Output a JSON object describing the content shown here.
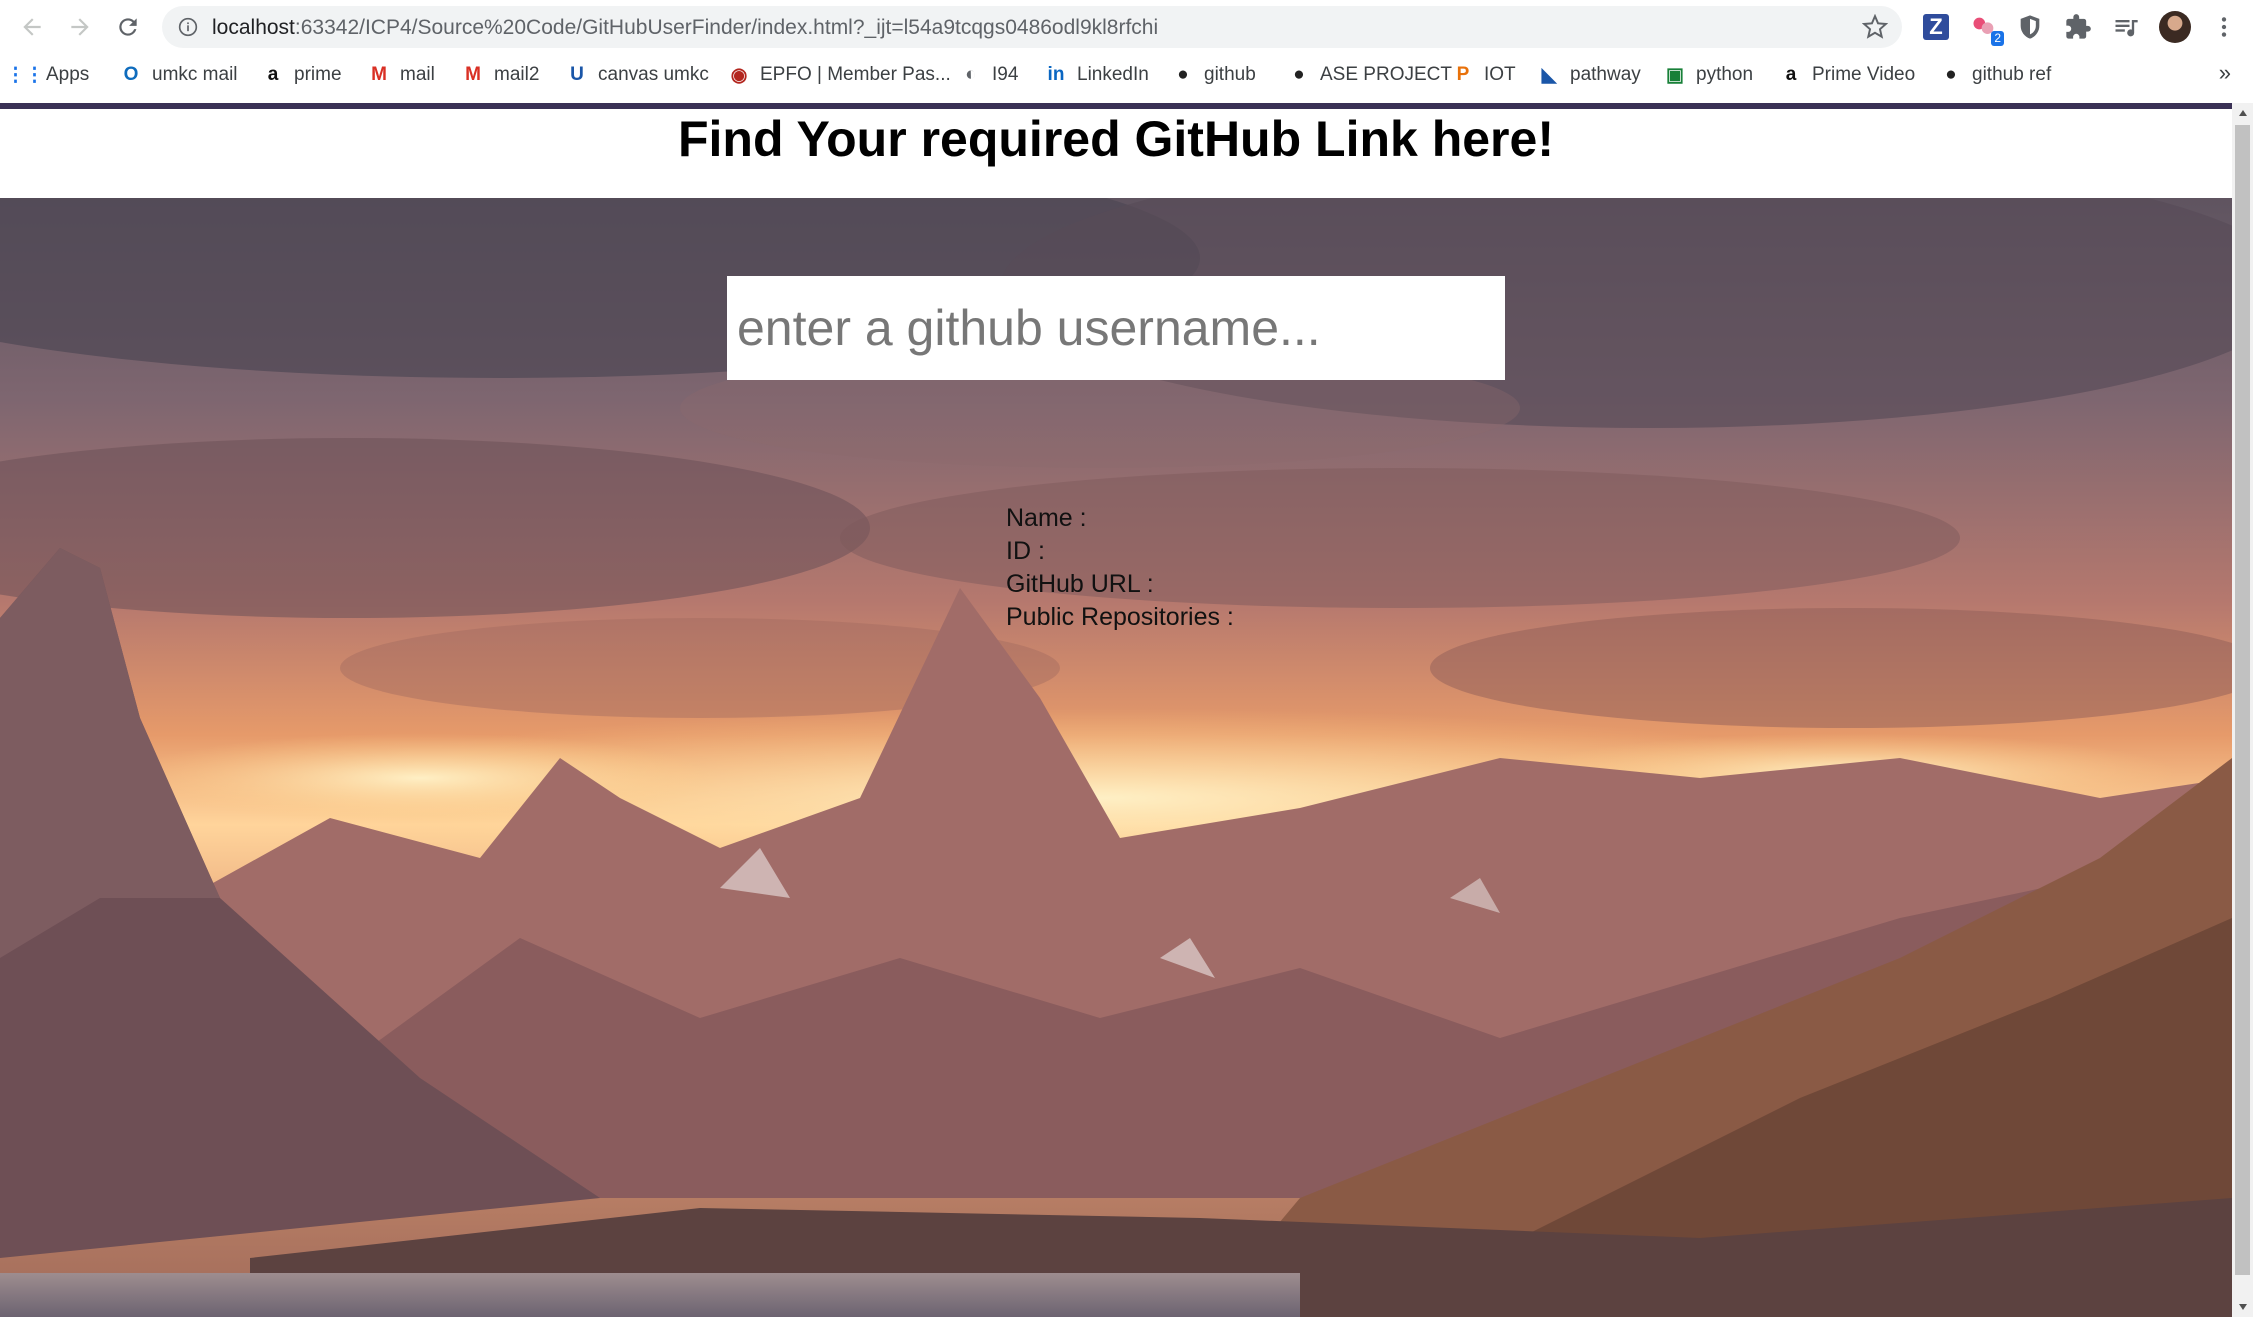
{
  "browser": {
    "url_host": "localhost",
    "url_path": ":63342/ICP4/Source%20Code/GitHubUserFinder/index.html?_ijt=l54a9tcqgs0486odl9kl8rfchi",
    "extension_badge": "2",
    "z_extension_label": "Z",
    "bookmarks": [
      {
        "label": "Apps",
        "icon": "apps-grid-icon"
      },
      {
        "label": "umkc mail",
        "icon": "outlook-icon"
      },
      {
        "label": "prime",
        "icon": "amazon-icon"
      },
      {
        "label": "mail",
        "icon": "gmail-icon"
      },
      {
        "label": "mail2",
        "icon": "gmail-icon"
      },
      {
        "label": "canvas umkc",
        "icon": "umkc-icon"
      },
      {
        "label": "EPFO | Member Pas...",
        "icon": "epfo-icon"
      },
      {
        "label": "I94",
        "icon": "globe-icon"
      },
      {
        "label": "LinkedIn",
        "icon": "linkedin-icon"
      },
      {
        "label": "github",
        "icon": "github-icon"
      },
      {
        "label": "ASE PROJECT",
        "icon": "github-icon"
      },
      {
        "label": "IOT",
        "icon": "p-icon"
      },
      {
        "label": "pathway",
        "icon": "pathway-icon"
      },
      {
        "label": "python",
        "icon": "sheets-icon"
      },
      {
        "label": "Prime Video",
        "icon": "amazon-icon"
      },
      {
        "label": "github ref",
        "icon": "github-icon"
      }
    ],
    "more_bookmarks": "»"
  },
  "page": {
    "title": "Find Your required GitHub Link here!",
    "search": {
      "placeholder": "enter a github username...",
      "value": ""
    },
    "user_info": {
      "name_label": "Name :",
      "id_label": "ID :",
      "url_label": "GitHub URL :",
      "repos_label": "Public Repositories :"
    }
  },
  "colors": {
    "accent_bar": "#3a3155",
    "omnibox": "#f1f3f4"
  }
}
